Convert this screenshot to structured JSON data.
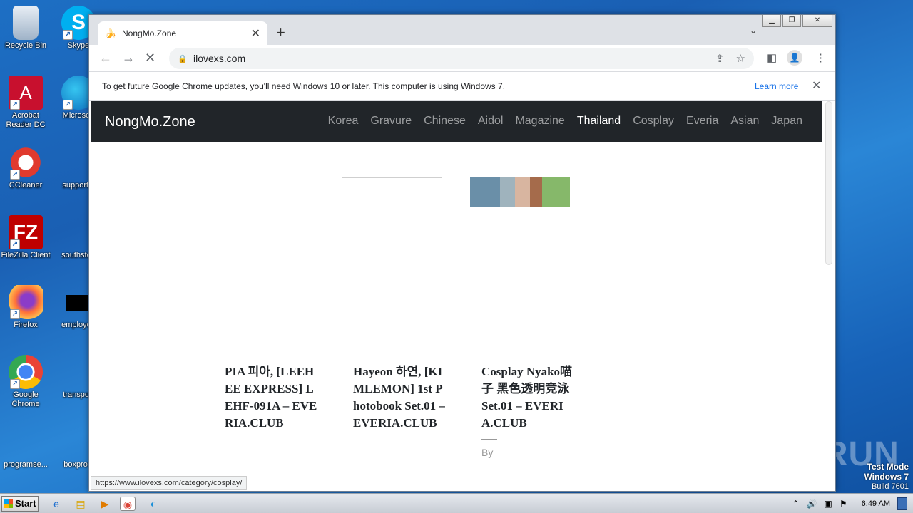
{
  "desktop": {
    "icons": [
      {
        "label": "Recycle Bin"
      },
      {
        "label": "Skype"
      },
      {
        "label": "Acrobat Reader DC"
      },
      {
        "label": "Microsoft"
      },
      {
        "label": "CCleaner"
      },
      {
        "label": "supportal"
      },
      {
        "label": "FileZilla Client"
      },
      {
        "label": "southstep"
      },
      {
        "label": "Firefox"
      },
      {
        "label": "employee"
      },
      {
        "label": "Google Chrome"
      },
      {
        "label": "transport"
      },
      {
        "label": "programse..."
      },
      {
        "label": "boxprovi"
      }
    ]
  },
  "browser": {
    "tab_title": "NongMo.Zone",
    "url": "ilovexs.com",
    "infobar_message": "To get future Google Chrome updates, you'll need Windows 10 or later. This computer is using Windows 7.",
    "infobar_link": "Learn more",
    "status_url": "https://www.ilovexs.com/category/cosplay/"
  },
  "page": {
    "brand": "NongMo.Zone",
    "nav": [
      "Korea",
      "Gravure",
      "Chinese",
      "Aidol",
      "Magazine",
      "Thailand",
      "Cosplay",
      "Everia",
      "Asian",
      "Japan"
    ],
    "active_nav": "Thailand",
    "posts": [
      {
        "title": "PIA 피아, [LEEHEE EXPRESS] LEHF-091A – EVERIA.CLUB"
      },
      {
        "title": "Hayeon 하연, [KIMLEMON] 1st Photobook Set.01 – EVERIA.CLUB"
      },
      {
        "title": "Cosplay Nyako喵子 黑色透明竞泳 Set.01 – EVERIA.CLUB",
        "meta": "By"
      }
    ]
  },
  "watermark": {
    "brand": "ANY RUN",
    "mode": "Test Mode",
    "os": "Windows 7",
    "build": "Build 7601"
  },
  "taskbar": {
    "start_label": "Start",
    "clock": "6:49 AM"
  }
}
